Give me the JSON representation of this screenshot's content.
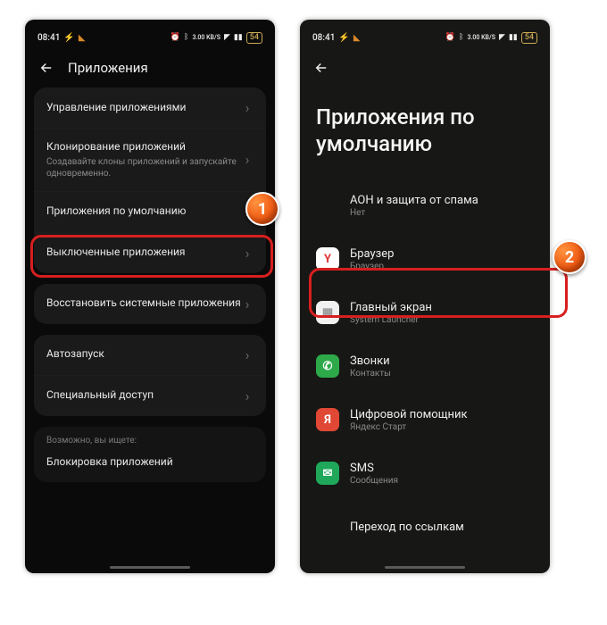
{
  "statusbar": {
    "time": "08:41",
    "net_label": "3.00 KB/S",
    "battery_label": "54"
  },
  "left": {
    "title": "Приложения",
    "groups": [
      [
        {
          "label": "Управление приложениями"
        },
        {
          "label": "Клонирование приложений",
          "sub": "Создавайте клоны приложений и запускайте одновременно."
        },
        {
          "label": "Приложения по умолчанию"
        },
        {
          "label": "Выключенные приложения"
        }
      ],
      [
        {
          "label": "Восстановить системные приложения"
        }
      ],
      [
        {
          "label": "Автозапуск"
        },
        {
          "label": "Специальный доступ"
        }
      ]
    ],
    "search_heading": "Возможно, вы ищете:",
    "search_item": "Блокировка приложений"
  },
  "right": {
    "title": "Приложения по умолчанию",
    "items": [
      {
        "title": "АОН и защита от спама",
        "sub": "Нет",
        "icon": "none"
      },
      {
        "title": "Браузер",
        "sub": "Браузер",
        "icon": "yandex"
      },
      {
        "title": "Главный экран",
        "sub": "System Launcher",
        "icon": "white"
      },
      {
        "title": "Звонки",
        "sub": "Контакты",
        "icon": "contacts"
      },
      {
        "title": "Цифровой помощник",
        "sub": "Яндекс Старт",
        "icon": "ystart"
      },
      {
        "title": "SMS",
        "sub": "Сообщения",
        "icon": "sms"
      },
      {
        "title": "Переход по ссылкам",
        "sub": "",
        "icon": "none"
      }
    ]
  },
  "callouts": {
    "c1": "1",
    "c2": "2"
  }
}
